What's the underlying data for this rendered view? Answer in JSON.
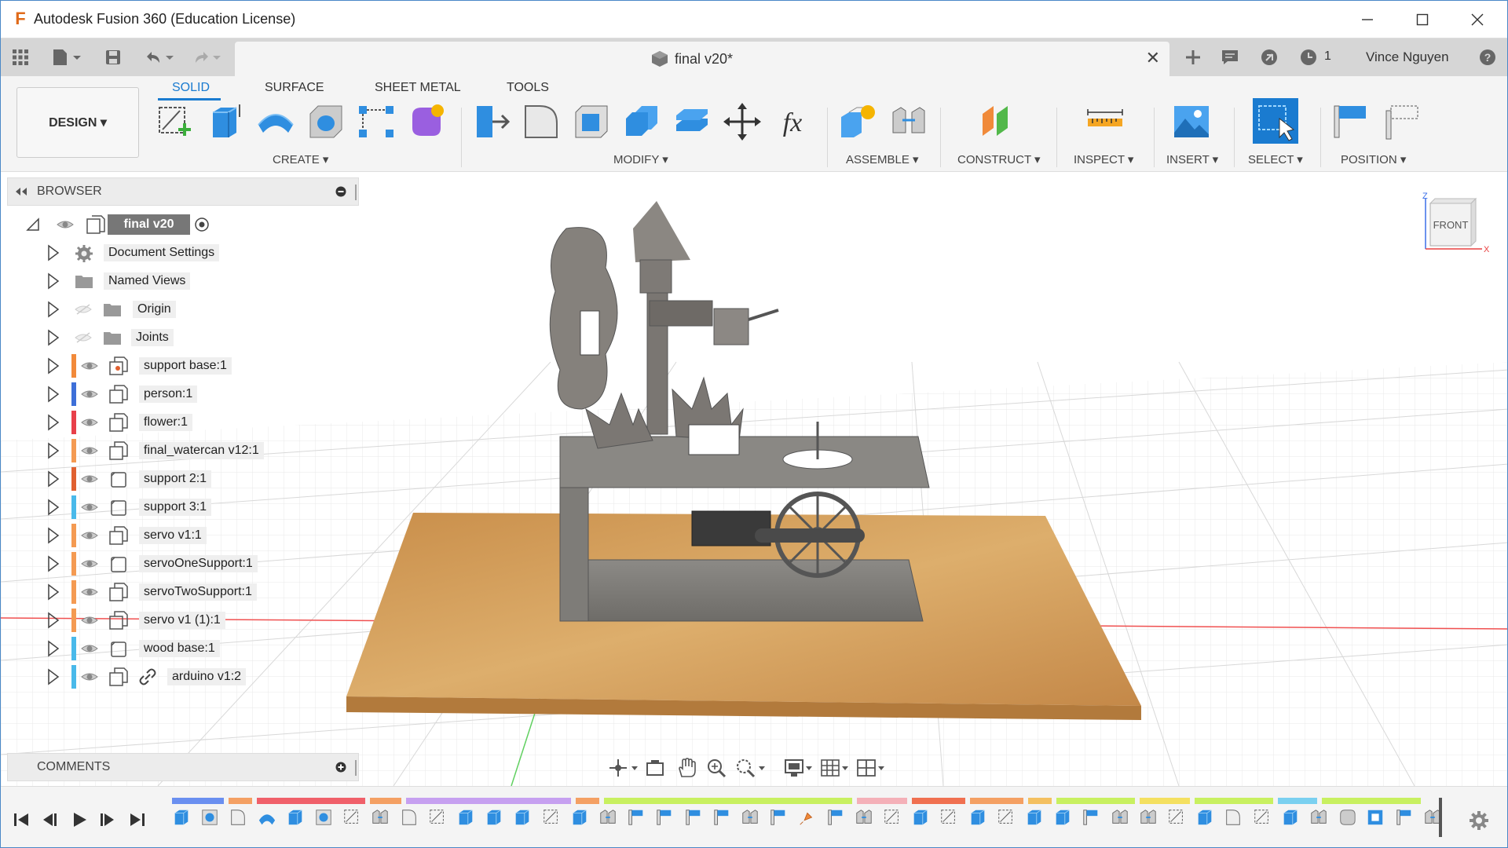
{
  "window": {
    "title": "Autodesk Fusion 360 (Education License)",
    "logo_letter": "F",
    "controls": [
      "minimize",
      "maximize",
      "close"
    ]
  },
  "tabbar": {
    "document_title": "final v20*",
    "job_count": "1",
    "user_name": "Vince Nguyen"
  },
  "workspace": {
    "label": "DESIGN ▾"
  },
  "ribbon_tabs": [
    {
      "label": "SOLID",
      "active": true
    },
    {
      "label": "SURFACE",
      "active": false
    },
    {
      "label": "SHEET METAL",
      "active": false
    },
    {
      "label": "TOOLS",
      "active": false
    }
  ],
  "ribbon_groups": {
    "create": "CREATE ▾",
    "modify": "MODIFY ▾",
    "assemble": "ASSEMBLE ▾",
    "construct": "CONSTRUCT ▾",
    "inspect": "INSPECT ▾",
    "insert": "INSERT ▾",
    "select": "SELECT ▾",
    "position": "POSITION ▾"
  },
  "modify_fx_label": "fx",
  "browser": {
    "title": "BROWSER",
    "root": "final v20",
    "items": [
      {
        "label": "Document Settings",
        "color": ""
      },
      {
        "label": "Named Views",
        "color": ""
      },
      {
        "label": "Origin",
        "color": ""
      },
      {
        "label": "Joints",
        "color": ""
      },
      {
        "label": "support base:1",
        "color": "#f28a3a"
      },
      {
        "label": "person:1",
        "color": "#3d6fd8"
      },
      {
        "label": "flower:1",
        "color": "#e8404a"
      },
      {
        "label": "final_watercan v12:1",
        "color": "#f49a52"
      },
      {
        "label": "support 2:1",
        "color": "#e06030"
      },
      {
        "label": "support 3:1",
        "color": "#49b9ea"
      },
      {
        "label": "servo v1:1",
        "color": "#f49a52"
      },
      {
        "label": "servoOneSupport:1",
        "color": "#f49a52"
      },
      {
        "label": "servoTwoSupport:1",
        "color": "#f49a52"
      },
      {
        "label": "servo v1 (1):1",
        "color": "#f49a52"
      },
      {
        "label": "wood base:1",
        "color": "#49b9ea"
      },
      {
        "label": "arduino v1:2",
        "color": "#49b9ea"
      }
    ]
  },
  "comments": {
    "title": "COMMENTS"
  },
  "viewcube": {
    "face_label": "FRONT",
    "axis_z": "Z",
    "axis_x": "X"
  },
  "timeline_groups": [
    {
      "color": "#6a8ff0"
    },
    {
      "color": "#f4a063"
    },
    {
      "color": "#f0606a"
    },
    {
      "color": "#f4a063"
    },
    {
      "color": "#c6a0f0"
    },
    {
      "color": "#f4a063"
    },
    {
      "color": "#c8f060"
    },
    {
      "color": "#f4b0b8"
    },
    {
      "color": "#f07050"
    },
    {
      "color": "#f4a063"
    },
    {
      "color": "#f4c060"
    },
    {
      "color": "#c8f060"
    },
    {
      "color": "#f4e060"
    },
    {
      "color": "#c8f060"
    },
    {
      "color": "#7ad0f0"
    },
    {
      "color": "#c8f060"
    }
  ]
}
